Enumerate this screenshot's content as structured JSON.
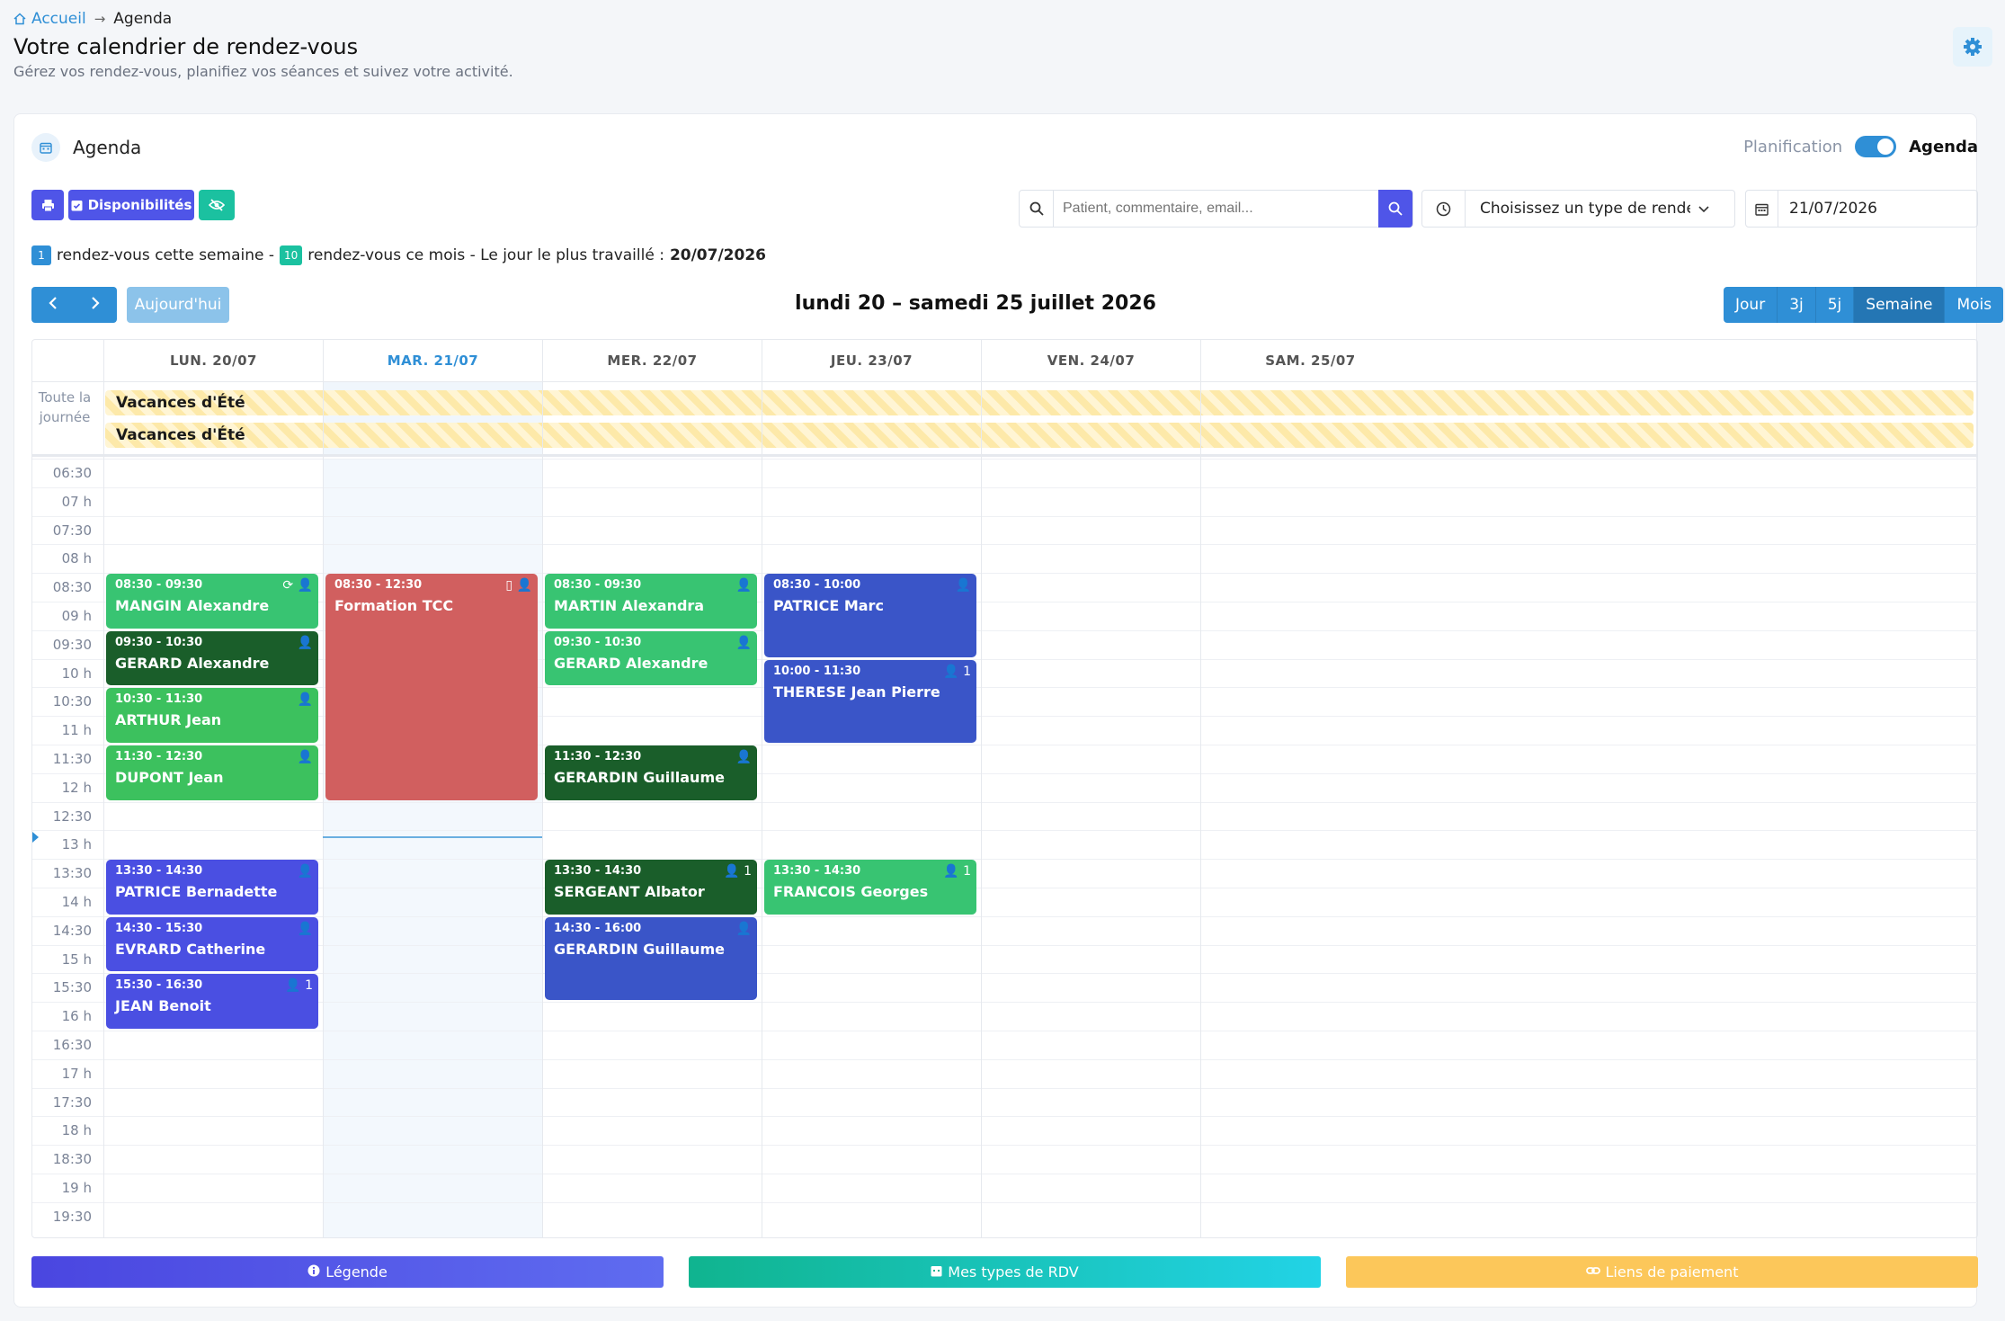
{
  "breadcrumb": {
    "home": "Accueil",
    "current": "Agenda"
  },
  "page": {
    "title": "Votre calendrier de rendez-vous",
    "subtitle": "Gérez vos rendez-vous, planifiez vos séances et suivez votre activité."
  },
  "agenda": {
    "title": "Agenda",
    "toggle_off": "Planification",
    "toggle_on": "Agenda"
  },
  "toolbar": {
    "availability": "Disponibilités"
  },
  "search": {
    "placeholder": "Patient, commentaire, email..."
  },
  "type_select": {
    "value": "Choisissez un type de rendez-vous"
  },
  "date_field": {
    "value": "21/07/2026"
  },
  "stats": {
    "week_count": "1",
    "week_text": "rendez-vous cette semaine -",
    "month_count": "10",
    "month_text": "rendez-vous ce mois - Le jour le plus travaillé :",
    "busiest_day": "20/07/2026"
  },
  "nav": {
    "today": "Aujourd'hui",
    "range": "lundi 20 – samedi 25 juillet 2026"
  },
  "views": [
    "Jour",
    "3j",
    "5j",
    "Semaine",
    "Mois"
  ],
  "days": [
    "LUN. 20/07",
    "MAR. 21/07",
    "MER. 22/07",
    "JEU. 23/07",
    "VEN. 24/07",
    "SAM. 25/07"
  ],
  "allday": {
    "label": "Toute la journée",
    "events": [
      "Vacances d'Été",
      "Vacances d'Été"
    ]
  },
  "times": [
    "06:30",
    "07 h",
    "07:30",
    "08 h",
    "08:30",
    "09 h",
    "09:30",
    "10 h",
    "10:30",
    "11 h",
    "11:30",
    "12 h",
    "12:30",
    "13 h",
    "13:30",
    "14 h",
    "14:30",
    "15 h",
    "15:30",
    "16 h",
    "16:30",
    "17 h",
    "17:30",
    "18 h",
    "18:30",
    "19 h",
    "19:30"
  ],
  "events": [
    {
      "day": 0,
      "start": "08:30",
      "end": "09:30",
      "time": "08:30 - 09:30",
      "name": "MANGIN Alexandre",
      "color": "#38c472",
      "icons": "⟳ 👤"
    },
    {
      "day": 0,
      "start": "09:30",
      "end": "10:30",
      "time": "09:30 - 10:30",
      "name": "GERARD Alexandre",
      "color": "#1a5e2a",
      "icons": "👤"
    },
    {
      "day": 0,
      "start": "10:30",
      "end": "11:30",
      "time": "10:30 - 11:30",
      "name": "ARTHUR Jean",
      "color": "#3cc15e",
      "icons": "👤"
    },
    {
      "day": 0,
      "start": "11:30",
      "end": "12:30",
      "time": "11:30 - 12:30",
      "name": "DUPONT Jean",
      "color": "#3cc15e",
      "icons": "👤"
    },
    {
      "day": 0,
      "start": "13:30",
      "end": "14:30",
      "time": "13:30 - 14:30",
      "name": "PATRICE Bernadette",
      "color": "#4a4fe2",
      "icons": "👤"
    },
    {
      "day": 0,
      "start": "14:30",
      "end": "15:30",
      "time": "14:30 - 15:30",
      "name": "EVRARD Catherine",
      "color": "#4a4fe2",
      "icons": "👤"
    },
    {
      "day": 0,
      "start": "15:30",
      "end": "16:30",
      "time": "15:30 - 16:30",
      "name": "JEAN Benoit",
      "color": "#4a4fe2",
      "icons": "👤 1"
    },
    {
      "day": 1,
      "start": "08:30",
      "end": "12:30",
      "time": "08:30 - 12:30",
      "name": "Formation TCC",
      "color": "#d15f5f",
      "icons": "▯ 👤"
    },
    {
      "day": 2,
      "start": "08:30",
      "end": "09:30",
      "time": "08:30 - 09:30",
      "name": "MARTIN Alexandra",
      "color": "#38c472",
      "icons": "👤"
    },
    {
      "day": 2,
      "start": "09:30",
      "end": "10:30",
      "time": "09:30 - 10:30",
      "name": "GERARD Alexandre",
      "color": "#38c472",
      "icons": "👤"
    },
    {
      "day": 2,
      "start": "11:30",
      "end": "12:30",
      "time": "11:30 - 12:30",
      "name": "GERARDIN Guillaume",
      "color": "#1a5e2a",
      "icons": "👤"
    },
    {
      "day": 2,
      "start": "13:30",
      "end": "14:30",
      "time": "13:30 - 14:30",
      "name": "SERGEANT Albator",
      "color": "#1a5e2a",
      "icons": "👤 1"
    },
    {
      "day": 2,
      "start": "14:30",
      "end": "16:00",
      "time": "14:30 - 16:00",
      "name": "GERARDIN Guillaume",
      "color": "#3a55c8",
      "icons": "👤"
    },
    {
      "day": 3,
      "start": "08:30",
      "end": "10:00",
      "time": "08:30 - 10:00",
      "name": "PATRICE Marc",
      "color": "#3a55c8",
      "icons": "👤"
    },
    {
      "day": 3,
      "start": "10:00",
      "end": "11:30",
      "time": "10:00 - 11:30",
      "name": "THERESE Jean Pierre",
      "color": "#3a55c8",
      "icons": "👤 1"
    },
    {
      "day": 3,
      "start": "13:30",
      "end": "14:30",
      "time": "13:30 - 14:30",
      "name": "FRANCOIS Georges",
      "color": "#38c472",
      "icons": "👤 1"
    }
  ],
  "footer": {
    "legend": "Légende",
    "types": "Mes types de RDV",
    "payment": "Liens de paiement"
  },
  "colors": {
    "accent": "#2f8fd6",
    "primary": "#4f55e8",
    "teal": "#1bc1a0"
  }
}
